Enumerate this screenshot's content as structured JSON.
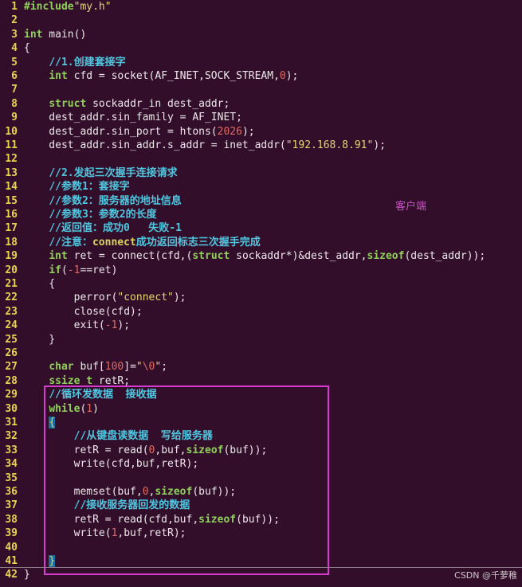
{
  "editor": {
    "lines": [
      {
        "num": "1",
        "tokens": [
          [
            "pp",
            "#include"
          ],
          [
            "str",
            "\"my.h\""
          ]
        ]
      },
      {
        "num": "2",
        "tokens": []
      },
      {
        "num": "3",
        "tokens": [
          [
            "kw",
            "int"
          ],
          [
            "",
            " main()"
          ]
        ]
      },
      {
        "num": "4",
        "tokens": [
          [
            "",
            "{"
          ]
        ]
      },
      {
        "num": "5",
        "tokens": [
          [
            "",
            "    "
          ],
          [
            "cm",
            "//1.创建套接字"
          ]
        ]
      },
      {
        "num": "6",
        "tokens": [
          [
            "",
            "    "
          ],
          [
            "kw",
            "int"
          ],
          [
            "",
            " cfd = socket(AF_INET,SOCK_STREAM,"
          ],
          [
            "num",
            "0"
          ],
          [
            "",
            ");"
          ]
        ]
      },
      {
        "num": "7",
        "tokens": []
      },
      {
        "num": "8",
        "tokens": [
          [
            "",
            "    "
          ],
          [
            "kw",
            "struct"
          ],
          [
            "",
            " sockaddr_in dest_addr;"
          ]
        ]
      },
      {
        "num": "9",
        "tokens": [
          [
            "",
            "    dest_addr.sin_family = AF_INET;"
          ]
        ]
      },
      {
        "num": "10",
        "tokens": [
          [
            "",
            "    dest_addr.sin_port = htons("
          ],
          [
            "num",
            "2026"
          ],
          [
            "",
            ");"
          ]
        ]
      },
      {
        "num": "11",
        "tokens": [
          [
            "",
            "    dest_addr.sin_addr.s_addr = inet_addr("
          ],
          [
            "str",
            "\"192.168.8.91\""
          ],
          [
            "",
            ");"
          ]
        ]
      },
      {
        "num": "12",
        "tokens": []
      },
      {
        "num": "13",
        "tokens": [
          [
            "",
            "    "
          ],
          [
            "cm",
            "//2.发起三次握手连接请求"
          ]
        ]
      },
      {
        "num": "14",
        "tokens": [
          [
            "",
            "    "
          ],
          [
            "cm",
            "//参数1：套接字"
          ]
        ]
      },
      {
        "num": "15",
        "tokens": [
          [
            "",
            "    "
          ],
          [
            "cm",
            "//参数2：服务器的地址信息"
          ]
        ]
      },
      {
        "num": "16",
        "tokens": [
          [
            "",
            "    "
          ],
          [
            "cm",
            "//参数3：参数2的长度"
          ]
        ]
      },
      {
        "num": "17",
        "tokens": [
          [
            "",
            "    "
          ],
          [
            "cm",
            "//返回值：成功0   失败-1"
          ]
        ]
      },
      {
        "num": "18",
        "tokens": [
          [
            "",
            "    "
          ],
          [
            "cm",
            "//注意："
          ],
          [
            "cn",
            "connect"
          ],
          [
            "cm",
            "成功返回标志三次握手完成"
          ]
        ]
      },
      {
        "num": "19",
        "tokens": [
          [
            "",
            "    "
          ],
          [
            "kw",
            "int"
          ],
          [
            "",
            " ret = connect(cfd,("
          ],
          [
            "kw",
            "struct"
          ],
          [
            "",
            " sockaddr*)&dest_addr,"
          ],
          [
            "kw",
            "sizeof"
          ],
          [
            "",
            "(dest_addr));"
          ]
        ]
      },
      {
        "num": "20",
        "tokens": [
          [
            "",
            "    "
          ],
          [
            "kw",
            "if"
          ],
          [
            "",
            "("
          ],
          [
            "num",
            "-1"
          ],
          [
            "",
            "==ret)"
          ]
        ]
      },
      {
        "num": "21",
        "tokens": [
          [
            "",
            "    {"
          ]
        ]
      },
      {
        "num": "22",
        "tokens": [
          [
            "",
            "        perror("
          ],
          [
            "str",
            "\"connect\""
          ],
          [
            "",
            ");"
          ]
        ]
      },
      {
        "num": "23",
        "tokens": [
          [
            "",
            "        close(cfd);"
          ]
        ]
      },
      {
        "num": "24",
        "tokens": [
          [
            "",
            "        exit("
          ],
          [
            "num",
            "-1"
          ],
          [
            "",
            ");"
          ]
        ]
      },
      {
        "num": "25",
        "tokens": [
          [
            "",
            "    }"
          ]
        ]
      },
      {
        "num": "26",
        "tokens": []
      },
      {
        "num": "27",
        "tokens": [
          [
            "",
            "    "
          ],
          [
            "kw",
            "char"
          ],
          [
            "",
            " buf["
          ],
          [
            "num",
            "100"
          ],
          [
            "",
            "]="
          ],
          [
            "str",
            "\""
          ],
          [
            "num",
            "\\0"
          ],
          [
            "str",
            "\""
          ],
          [
            "",
            ";"
          ]
        ]
      },
      {
        "num": "28",
        "tokens": [
          [
            "",
            "    "
          ],
          [
            "kw",
            "ssize t"
          ],
          [
            "",
            " retR;"
          ]
        ]
      },
      {
        "num": "29",
        "tokens": [
          [
            "",
            "    "
          ],
          [
            "cm",
            "//循环发数据  接收据"
          ]
        ]
      },
      {
        "num": "30",
        "tokens": [
          [
            "",
            "    "
          ],
          [
            "kw",
            "while"
          ],
          [
            "",
            "("
          ],
          [
            "num",
            "1"
          ],
          [
            "",
            ")"
          ]
        ]
      },
      {
        "num": "31",
        "tokens": [
          [
            "",
            "    "
          ],
          [
            "cur",
            "{"
          ]
        ]
      },
      {
        "num": "32",
        "tokens": [
          [
            "",
            "        "
          ],
          [
            "cm",
            "//从键盘读数据  写给服务器"
          ]
        ]
      },
      {
        "num": "33",
        "tokens": [
          [
            "",
            "        retR = read("
          ],
          [
            "num",
            "0"
          ],
          [
            "",
            ",buf,"
          ],
          [
            "kw",
            "sizeof"
          ],
          [
            "",
            "(buf));"
          ]
        ]
      },
      {
        "num": "34",
        "tokens": [
          [
            "",
            "        write(cfd,buf,retR);"
          ]
        ]
      },
      {
        "num": "35",
        "tokens": []
      },
      {
        "num": "36",
        "tokens": [
          [
            "",
            "        memset(buf,"
          ],
          [
            "num",
            "0"
          ],
          [
            "",
            ","
          ],
          [
            "kw",
            "sizeof"
          ],
          [
            "",
            "(buf));"
          ]
        ]
      },
      {
        "num": "37",
        "tokens": [
          [
            "",
            "        "
          ],
          [
            "cm",
            "//接收服务器回发的数据"
          ]
        ]
      },
      {
        "num": "38",
        "tokens": [
          [
            "",
            "        retR = read(cfd,buf,"
          ],
          [
            "kw",
            "sizeof"
          ],
          [
            "",
            "(buf));"
          ]
        ]
      },
      {
        "num": "39",
        "tokens": [
          [
            "",
            "        write("
          ],
          [
            "num",
            "1"
          ],
          [
            "",
            ",buf,retR);"
          ]
        ]
      },
      {
        "num": "40",
        "tokens": []
      },
      {
        "num": "41",
        "tokens": [
          [
            "",
            "    "
          ],
          [
            "cur",
            "}"
          ]
        ]
      },
      {
        "num": "42",
        "tokens": [
          [
            "",
            "}"
          ]
        ]
      }
    ]
  },
  "annotation": {
    "label": "客户端",
    "box_color": "#d63bd0"
  },
  "watermark": "CSDN @千萝稚",
  "colors": {
    "background": "#330e2a",
    "line_numbers": "#e8d44a",
    "keyword": "#8fd15a",
    "comment": "#4fc7e0",
    "string": "#e3d872",
    "number": "#e06c64"
  }
}
